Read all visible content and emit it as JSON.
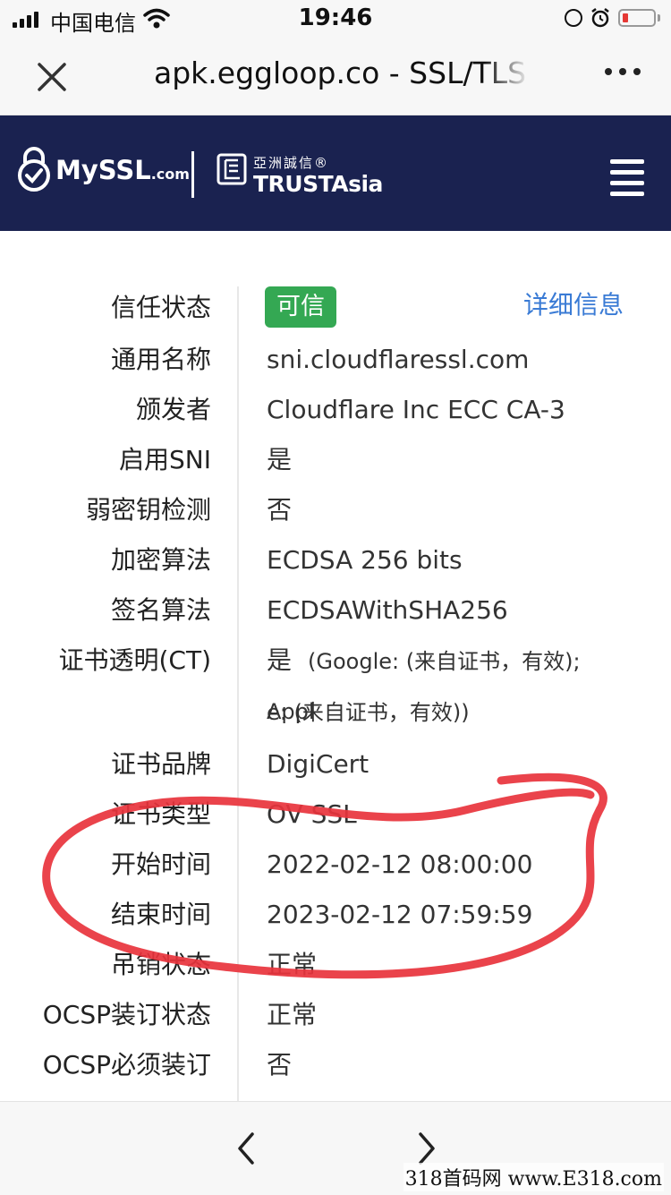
{
  "status_bar": {
    "carrier": "中国电信",
    "time": "19:46"
  },
  "browser": {
    "title": "apk.eggloop.co - SSL/TLS"
  },
  "header": {
    "brand_my": "My",
    "brand_ssl": "SSL",
    "brand_com": ".com",
    "partner_cn": "亞洲誠信®",
    "partner_en": "TRUSTAsia"
  },
  "cert": {
    "trust_status_label": "信任状态",
    "trust_status_value": "可信",
    "details_link": "详细信息",
    "rows": [
      {
        "label": "通用名称",
        "value": "sni.cloudflaressl.com"
      },
      {
        "label": "颁发者",
        "value": "Cloudflare Inc ECC CA-3"
      },
      {
        "label": "启用SNI",
        "value": "是"
      },
      {
        "label": "弱密钥检测",
        "value": "否"
      },
      {
        "label": "加密算法",
        "value": "ECDSA 256 bits"
      },
      {
        "label": "签名算法",
        "value": "ECDSAWithSHA256"
      }
    ],
    "ct_label": "证书透明(CT)",
    "ct_value_first": "是",
    "ct_value_line1": "(Google: (来自证书，有效); Appl",
    "ct_value_line2": "e: (来自证书，有效))",
    "rows2": [
      {
        "label": "证书品牌",
        "value": "DigiCert"
      },
      {
        "label": "证书类型",
        "value": "OV SSL"
      },
      {
        "label": "开始时间",
        "value": "2022-02-12 08:00:00"
      },
      {
        "label": "结束时间",
        "value": "2023-02-12 07:59:59"
      },
      {
        "label": "吊销状态",
        "value": "正常"
      },
      {
        "label": "OCSP装订状态",
        "value": "正常"
      },
      {
        "label": "OCSP必须装订",
        "value": "否"
      }
    ]
  },
  "watermark": "318首码网 www.E318.com",
  "colors": {
    "header_bg": "#1a2250",
    "badge_green": "#34a853",
    "link_blue": "#3a7bd5",
    "annotation_red": "#e8333c"
  }
}
